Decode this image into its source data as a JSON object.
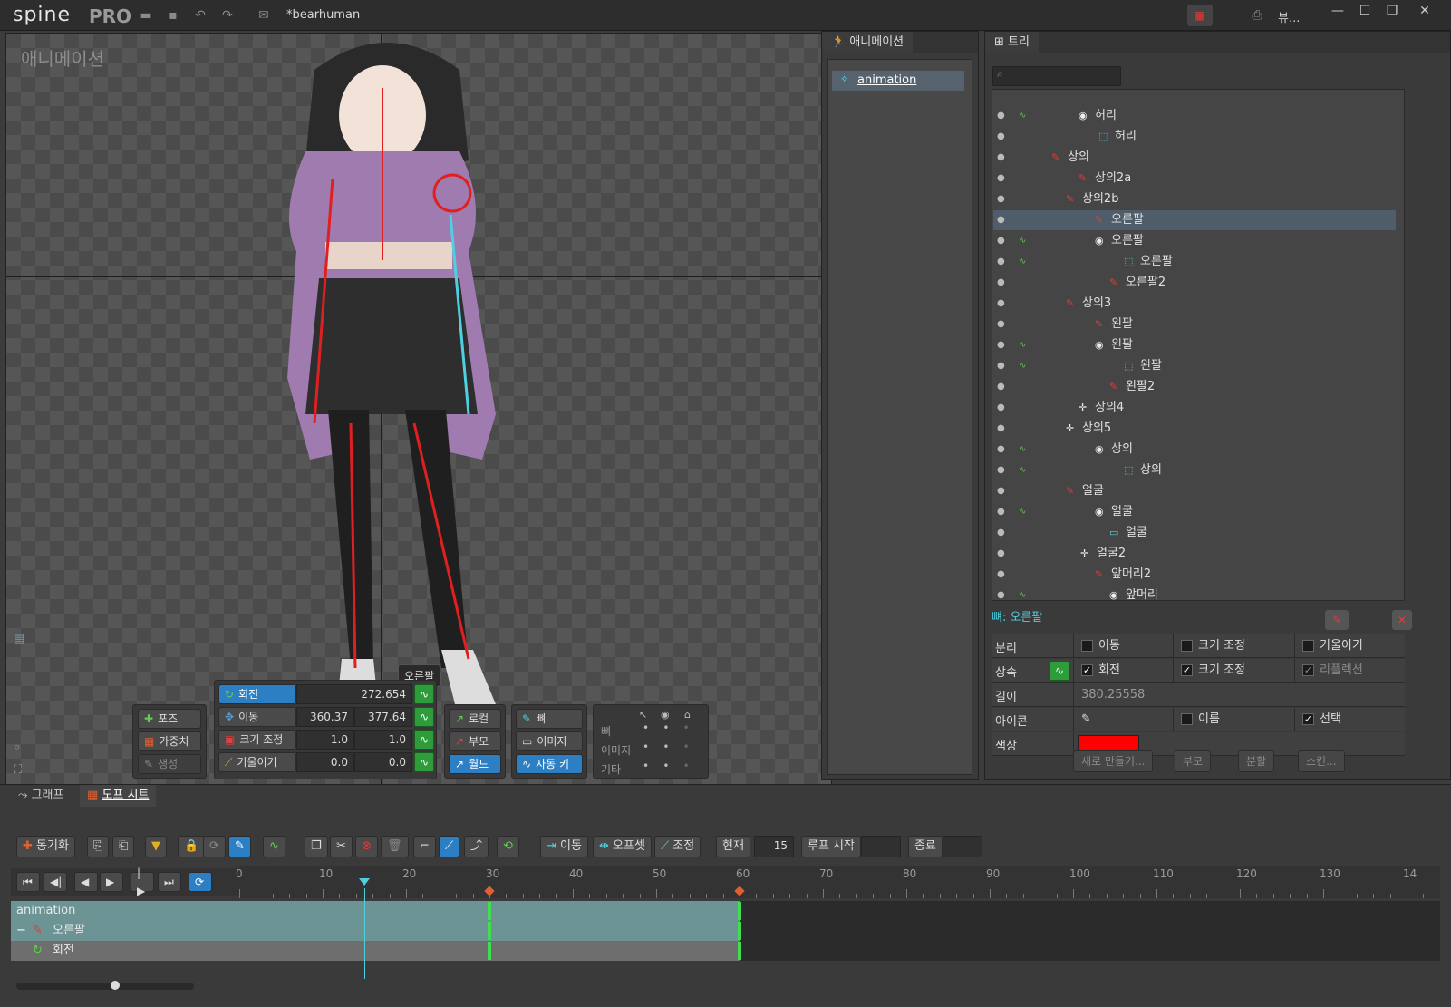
{
  "app": {
    "logo": "spine",
    "edition": "PRO",
    "file_title": "*bearhuman",
    "view_menu": "뷰..."
  },
  "viewport": {
    "title": "애니메이션",
    "bone_tooltip": "오른팔"
  },
  "transform": {
    "rotate": {
      "label": "회전",
      "value": "272.654"
    },
    "translate": {
      "label": "이동",
      "x": "360.37",
      "y": "377.64"
    },
    "scale": {
      "label": "크기 조정",
      "x": "1.0",
      "y": "1.0"
    },
    "shear": {
      "label": "기울이기",
      "x": "0.0",
      "y": "0.0"
    }
  },
  "modes": {
    "pose": "포즈",
    "weights": "가중치",
    "create": "생성"
  },
  "axes": {
    "local": "로컬",
    "parent": "부모",
    "world": "월드"
  },
  "options": {
    "bones": "뼈",
    "images": "이미지",
    "auto_key": "자동 키"
  },
  "visibility": {
    "rows": [
      "뼈",
      "이미지",
      "기타"
    ]
  },
  "anim_panel": {
    "tab": "애니메이션",
    "item": "animation"
  },
  "tree_panel": {
    "tab": "트리",
    "rows": [
      {
        "name": "허리",
        "type": "slot"
      },
      {
        "name": "허리",
        "type": "mesh"
      },
      {
        "name": "상의",
        "type": "bone"
      },
      {
        "name": "상의2a",
        "type": "bone"
      },
      {
        "name": "상의2b",
        "type": "bone"
      },
      {
        "name": "오른팔",
        "type": "bone"
      },
      {
        "name": "오른팔",
        "type": "slot"
      },
      {
        "name": "오른팔",
        "type": "mesh"
      },
      {
        "name": "오른팔2",
        "type": "bone"
      },
      {
        "name": "상의3",
        "type": "bone"
      },
      {
        "name": "왼팔",
        "type": "bone"
      },
      {
        "name": "왼팔",
        "type": "slot"
      },
      {
        "name": "왼팔",
        "type": "mesh"
      },
      {
        "name": "왼팔2",
        "type": "bone"
      },
      {
        "name": "상의4",
        "type": "point"
      },
      {
        "name": "상의5",
        "type": "point"
      },
      {
        "name": "상의",
        "type": "slot"
      },
      {
        "name": "상의",
        "type": "mesh"
      },
      {
        "name": "얼굴",
        "type": "bone"
      },
      {
        "name": "얼굴",
        "type": "slot"
      },
      {
        "name": "얼굴",
        "type": "region"
      },
      {
        "name": "얼굴2",
        "type": "point"
      },
      {
        "name": "앞머리2",
        "type": "bone"
      },
      {
        "name": "앞머리",
        "type": "slot"
      }
    ]
  },
  "properties": {
    "title": "뼈: 오른팔",
    "disjoint": "분리",
    "inherit": "상속",
    "length": "길이",
    "length_value": "380.25558",
    "icon": "아이콘",
    "color": "색상",
    "color_hex": "#ff0000",
    "translate": "이동",
    "scale": "크기 조정",
    "shear": "기울이기",
    "rotate": "회전",
    "reflection": "리플렉션",
    "name": "이름",
    "select": "선택",
    "new": "새로 만들기...",
    "parent": "부모",
    "split": "분할",
    "skin": "스킨..."
  },
  "bottom_tabs": {
    "graph": "그래프",
    "dopesheet": "도프 시트"
  },
  "dopesheet": {
    "sync": "동기화",
    "move": "이동",
    "offset": "오프셋",
    "adjust": "조정",
    "current_label": "현재",
    "current_value": "15",
    "loop_start": "루프 시작",
    "end": "종료",
    "ticks": [
      "0",
      "10",
      "20",
      "30",
      "40",
      "50",
      "60",
      "70",
      "80",
      "90",
      "100",
      "110",
      "120",
      "130",
      "14"
    ],
    "tracks": [
      {
        "label": "animation"
      },
      {
        "label": "오른팔"
      },
      {
        "label": "회전"
      }
    ]
  }
}
